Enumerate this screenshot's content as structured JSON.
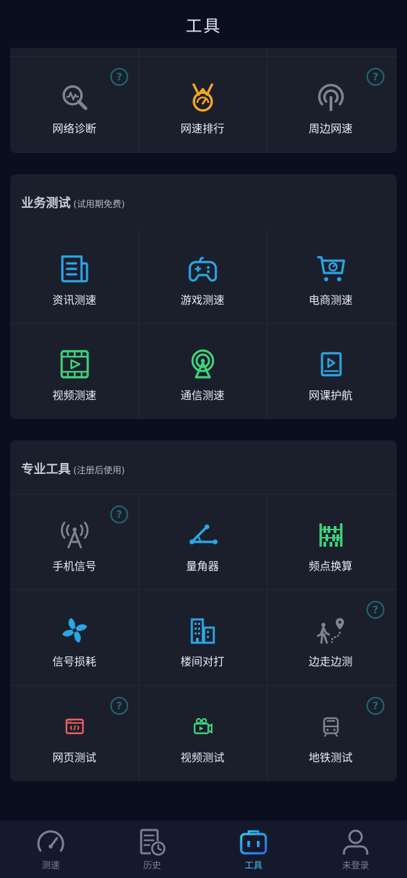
{
  "header": {
    "title": "工具"
  },
  "top_section": {
    "items": [
      {
        "label": "网络诊断",
        "icon": "network-diagnosis-icon",
        "help": true,
        "help_mark": "?"
      },
      {
        "label": "网速排行",
        "icon": "speed-medal-icon",
        "help": false
      },
      {
        "label": "周边网速",
        "icon": "nearby-signal-icon",
        "help": true,
        "help_mark": "?"
      }
    ]
  },
  "business": {
    "title": "业务测试",
    "subtitle": "(试用期免费)",
    "items": [
      {
        "label": "资讯测速",
        "icon": "news-icon",
        "color": "#2aa7e6"
      },
      {
        "label": "游戏测速",
        "icon": "gamepad-icon",
        "color": "#2aa7e6"
      },
      {
        "label": "电商测速",
        "icon": "shopping-cart-icon",
        "color": "#2aa7e6"
      },
      {
        "label": "视频测速",
        "icon": "film-icon",
        "color": "#3ed37a"
      },
      {
        "label": "通信测速",
        "icon": "tower-icon",
        "color": "#3ed37a"
      },
      {
        "label": "网课护航",
        "icon": "course-play-icon",
        "color": "#2aa7e6"
      }
    ]
  },
  "pro": {
    "title": "专业工具",
    "subtitle": "(注册后使用)",
    "items": [
      {
        "label": "手机信号",
        "icon": "antenna-icon",
        "help": true,
        "help_mark": "?"
      },
      {
        "label": "量角器",
        "icon": "protractor-icon",
        "help": false
      },
      {
        "label": "频点换算",
        "icon": "abacus-icon",
        "help": false
      },
      {
        "label": "信号损耗",
        "icon": "fan-icon",
        "help": false
      },
      {
        "label": "楼间对打",
        "icon": "buildings-icon",
        "help": false
      },
      {
        "label": "边走边测",
        "icon": "walking-route-icon",
        "help": true,
        "help_mark": "?"
      },
      {
        "label": "网页测试",
        "icon": "webpage-code-icon",
        "help": true,
        "help_mark": "?"
      },
      {
        "label": "视频测试",
        "icon": "video-camera-icon",
        "help": false
      },
      {
        "label": "地铁测试",
        "icon": "subway-train-icon",
        "help": true,
        "help_mark": "?"
      }
    ]
  },
  "tabbar": {
    "active": "工具",
    "items": [
      {
        "label": "测速",
        "icon": "speedometer-icon"
      },
      {
        "label": "历史",
        "icon": "history-doc-icon"
      },
      {
        "label": "工具",
        "icon": "toolbox-icon"
      },
      {
        "label": "未登录",
        "icon": "user-icon"
      }
    ]
  },
  "colors": {
    "background": "#0a0e1f",
    "card": "#1b1f2c",
    "blue": "#2aa7e6",
    "green": "#3ed37a",
    "orange": "#f5a623",
    "gray_icon": "#7f8593",
    "help": "#1f6b74",
    "tab_active": "#4fc3f7"
  }
}
